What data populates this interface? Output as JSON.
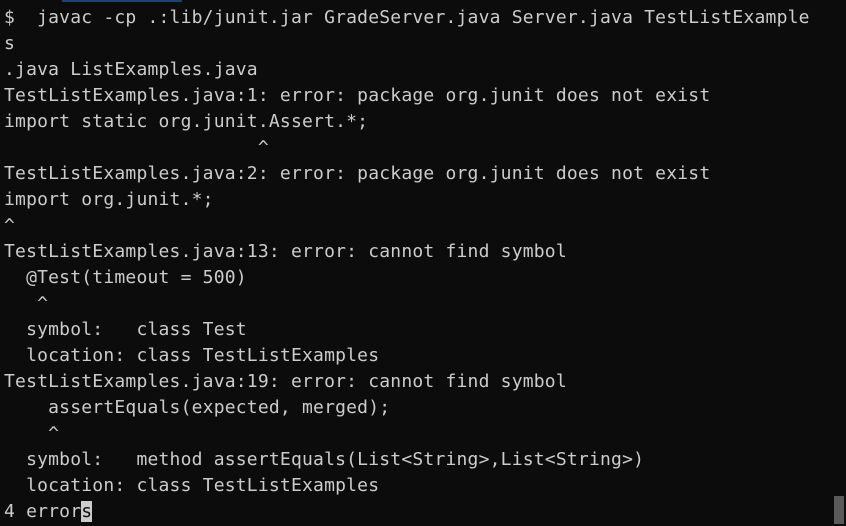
{
  "terminal": {
    "lines": [
      "$  javac -cp .:lib/junit.jar GradeServer.java Server.java TestListExample",
      "s",
      ".java ListExamples.java",
      "TestListExamples.java:1: error: package org.junit does not exist",
      "import static org.junit.Assert.*;",
      "                       ^",
      "TestListExamples.java:2: error: package org.junit does not exist",
      "import org.junit.*;",
      "^",
      "TestListExamples.java:13: error: cannot find symbol",
      "  @Test(timeout = 500)",
      "   ^",
      "  symbol:   class Test",
      "  location: class TestListExamples",
      "TestListExamples.java:19: error: cannot find symbol",
      "    assertEquals(expected, merged);",
      "    ^",
      "  symbol:   method assertEquals(List<String>,List<String>)",
      "  location: class TestListExamples"
    ],
    "last_line_before_cursor": "4 error",
    "cursor_char": "s"
  }
}
